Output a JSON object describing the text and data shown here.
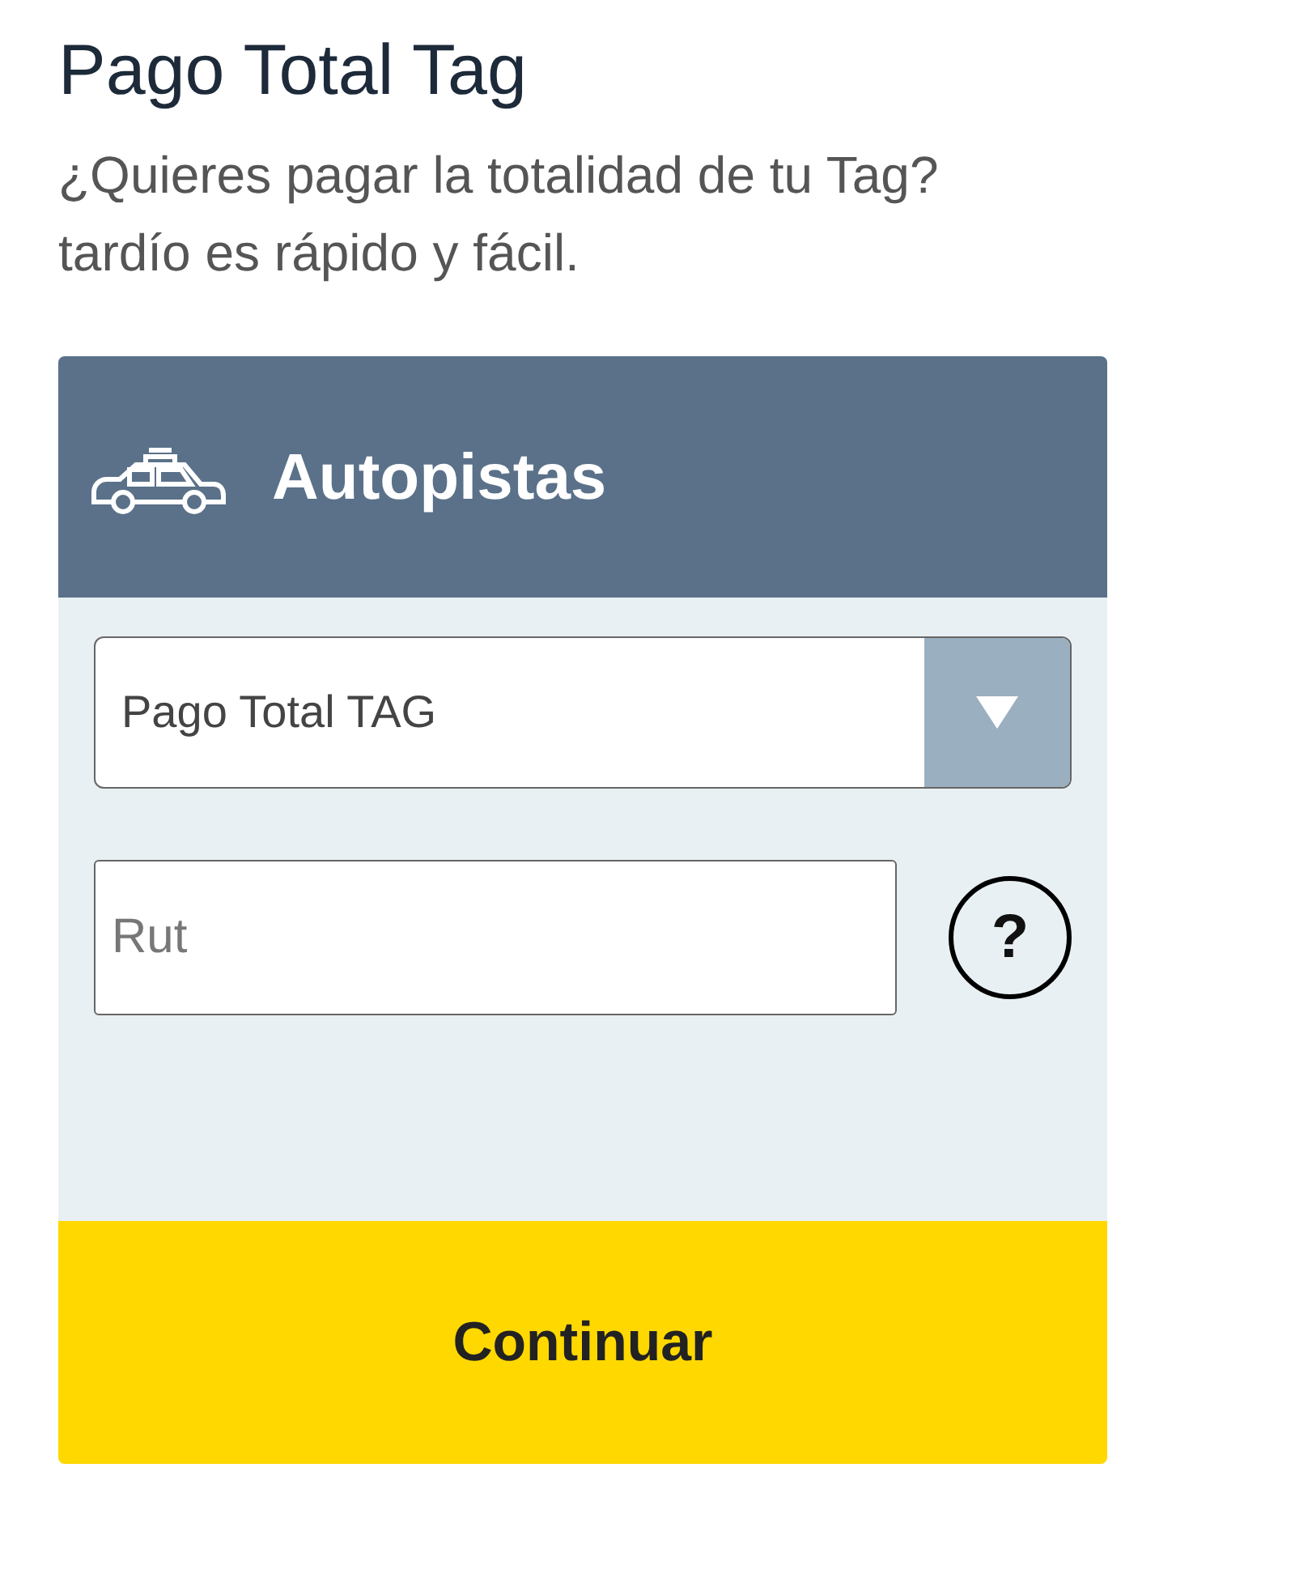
{
  "heading": "Pago Total Tag",
  "description_lines": [
    "¿Quieres pagar la totalidad de tu Tag?",
    "tardío es rápido y fácil."
  ],
  "card": {
    "title": "Autopistas",
    "select": {
      "value": "Pago Total TAG"
    },
    "rut_field": {
      "placeholder": "Rut"
    },
    "help": "?",
    "button": "Continuar"
  }
}
